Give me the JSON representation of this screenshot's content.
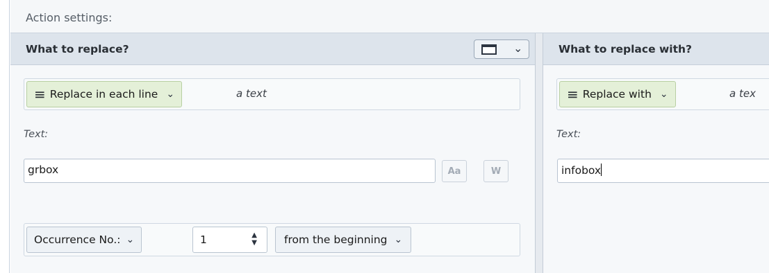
{
  "header": {
    "title": "Action settings:"
  },
  "left_panel": {
    "title": "What to replace?",
    "mode_button": {
      "label": "Replace in each line"
    },
    "mode_description": "a text",
    "text_label": "Text:",
    "text_value": "grbox",
    "case_button": "Aa",
    "word_button": "W",
    "occurrence_select": "Occurrence No.:",
    "occurrence_number": "1",
    "direction_select": "from the beginning"
  },
  "right_panel": {
    "title": "What to replace with?",
    "mode_button": {
      "label": "Replace with"
    },
    "mode_description": "a tex",
    "text_label": "Text:",
    "text_value": "infobox"
  },
  "colors": {
    "panel_header_bg": "#dde4ec",
    "mode_button_bg": "#e4f0d8",
    "panel_bg": "#f6f8fa"
  }
}
